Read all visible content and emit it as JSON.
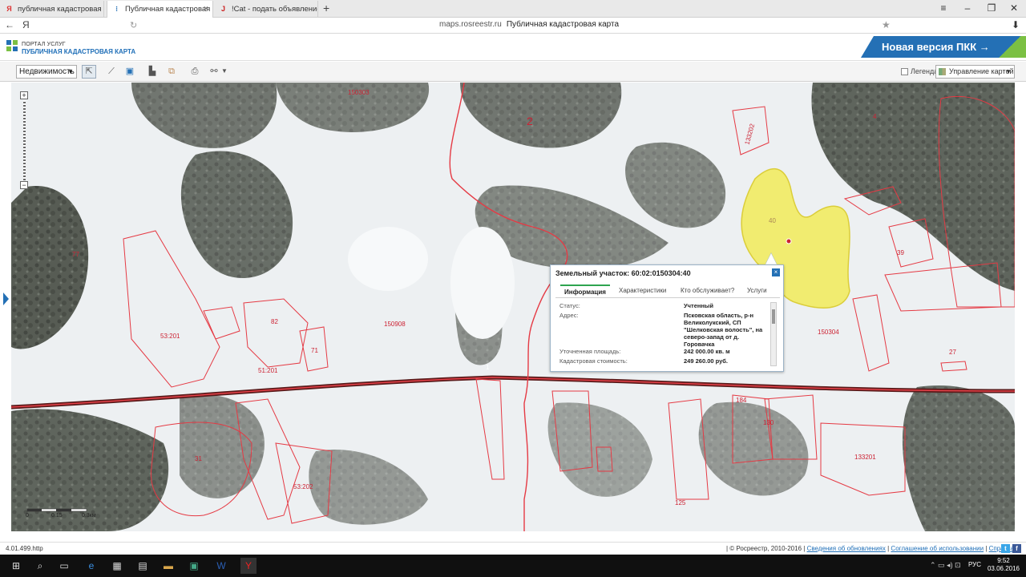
{
  "browser": {
    "tabs": [
      {
        "label": "публичная кадастровая карт",
        "active": false
      },
      {
        "label": "Публичная кадастровая",
        "active": true
      },
      {
        "label": "!Cat - подать объявление, р",
        "active": false
      }
    ],
    "new_tab": "+",
    "address_host": "maps.rosreestr.ru",
    "address_title": "Публичная кадастровая карта"
  },
  "header": {
    "portal_small": "ПОРТАЛ УСЛУГ",
    "portal_big": "ПУБЛИЧНАЯ КАДАСТРОВАЯ КАРТА",
    "new_version": "Новая версия ПКК →"
  },
  "toolbar": {
    "realty_select": "Недвижимость",
    "legend_label": "Легенда",
    "map_control_label": "Управление картой"
  },
  "map": {
    "labels": [
      "150303",
      "2",
      "133202",
      "150908",
      "53:201",
      "150304",
      "1",
      "39",
      "77",
      "82",
      "71",
      "31",
      "53:202",
      "184",
      "130",
      "133201",
      "125",
      "40",
      "4",
      "27",
      "51:201"
    ],
    "scale_labels": [
      "0",
      "0.15",
      "0.3км"
    ]
  },
  "popup": {
    "title": "Земельный участок: 60:02:0150304:40",
    "close": "×",
    "tabs": [
      "Информация",
      "Характеристики",
      "Кто обслуживает?",
      "Услуги"
    ],
    "rows": [
      {
        "label": "Статус:",
        "value": "Учтенный"
      },
      {
        "label": "Адрес:",
        "value": "Псковская область, р-н Великолукский, СП \"Шелковская волость\", на северо-запад от д. Горовачка"
      },
      {
        "label": "Уточненная площадь:",
        "value": "242 000.00 кв. м"
      },
      {
        "label": "Кадастровая стоимость:",
        "value": "249 260.00 руб."
      }
    ]
  },
  "status": {
    "version": "4.01.499.http",
    "copyright": "| © Росреестр, 2010-2016 |",
    "links": [
      "Сведения об обновлениях",
      "Соглашение об использовании",
      "Справка"
    ]
  },
  "taskbar": {
    "lang": "РУС",
    "time": "9:52",
    "date": "03.06.2016"
  }
}
